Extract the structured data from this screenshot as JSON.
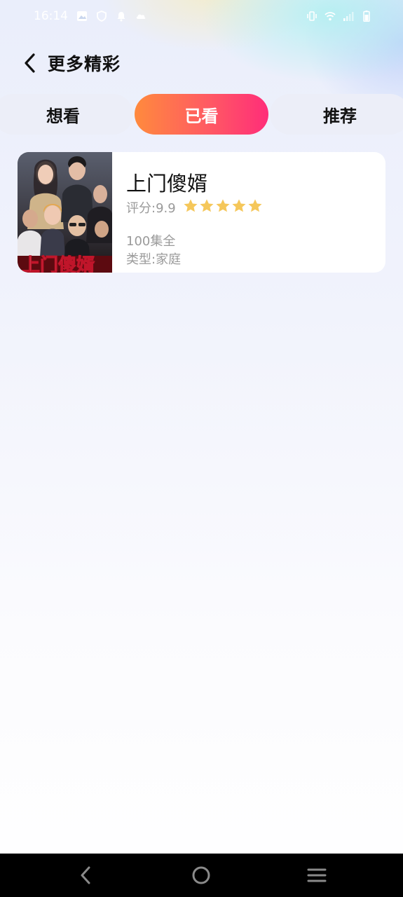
{
  "status_bar": {
    "time": "16:14",
    "icons": [
      "image-icon",
      "shield-icon",
      "bell-icon",
      "cloud-icon",
      "vibrate-icon",
      "wifi-icon",
      "signal-icon",
      "battery-icon"
    ]
  },
  "header": {
    "back_icon": "chevron-left-icon",
    "title": "更多精彩"
  },
  "tabs": [
    {
      "label": "想看",
      "active": false
    },
    {
      "label": "已看",
      "active": true
    },
    {
      "label": "推荐",
      "active": false
    }
  ],
  "items": [
    {
      "title": "上门傻婿",
      "rating_label": "评分:9.9",
      "rating": 5,
      "stars_max": 5,
      "episodes": "100集全",
      "genre": "类型:家庭",
      "poster_text": "上门傻婿"
    }
  ],
  "nav_bar": {
    "icons": [
      "back-triangle-icon",
      "home-circle-icon",
      "menu-lines-icon"
    ]
  },
  "colors": {
    "tab_active_start": "#ff8a3d",
    "tab_active_end": "#ff2d79",
    "star": "#f5c75a",
    "secondary_text": "#9a9a9a"
  }
}
